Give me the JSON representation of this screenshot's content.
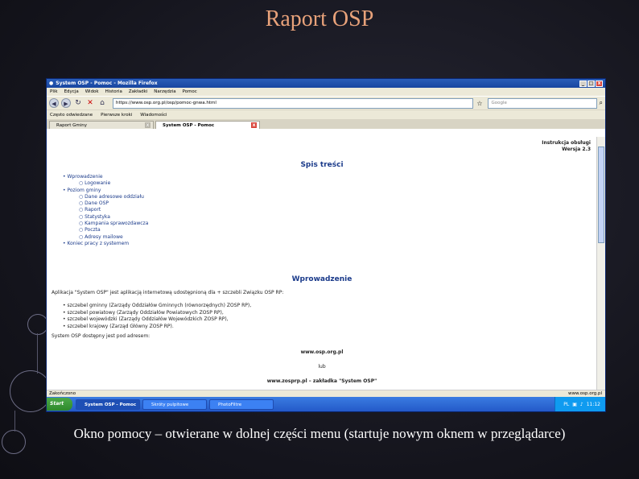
{
  "slide": {
    "title": "Raport OSP",
    "caption": "Okno pomocy – otwierane w dolnej części menu (startuje nowym oknem w przeglądarce)"
  },
  "browser": {
    "window_title": "System OSP - Pomoc - Mozilla Firefox",
    "menu": [
      "Plik",
      "Edycja",
      "Widok",
      "Historia",
      "Zakładki",
      "Narzędzia",
      "Pomoc"
    ],
    "url": "https://www.osp.org.pl/osp/pomoc-gnwa.html",
    "search_placeholder": "Google",
    "bookmarks": [
      "Często odwiedzane",
      "Pierwsze kroki",
      "Wiadomości"
    ],
    "tabs": [
      {
        "label": "Raport Gminy",
        "active": false
      },
      {
        "label": "System OSP - Pomoc",
        "active": true
      }
    ],
    "status_left": "Zakończono",
    "status_right": "www.osp.org.pl"
  },
  "page": {
    "version_line1": "Instrukcja obsługi",
    "version_line2": "Wersja 2.3",
    "toc_heading": "Spis treści",
    "toc": [
      {
        "level": 1,
        "text": "Wprowadzenie"
      },
      {
        "level": 2,
        "text": "Logowanie"
      },
      {
        "level": 1,
        "text": "Poziom gminy"
      },
      {
        "level": 2,
        "text": "Dane adresowe oddziału"
      },
      {
        "level": 2,
        "text": "Dane OSP"
      },
      {
        "level": 2,
        "text": "Raport"
      },
      {
        "level": 2,
        "text": "Statystyka"
      },
      {
        "level": 2,
        "text": "Kampania sprawozdawcza"
      },
      {
        "level": 2,
        "text": "Poczta"
      },
      {
        "level": 2,
        "text": "Adresy mailowe"
      },
      {
        "level": 1,
        "text": "Koniec pracy z systemem"
      }
    ],
    "intro_heading": "Wprowadzenie",
    "intro_text": "Aplikacja \"System OSP\" jest aplikacją internetową udostępnioną dla + szczebli Związku OSP RP:",
    "levels": [
      "szczebel gminny (Zarządy Oddziałów Gminnych (równorzędnych) ZOSP RP),",
      "szczebel powiatowy (Zarządy Oddziałów Powiatowych ZOSP RP),",
      "szczebel wojewódzki (Zarządy Oddziałów Wojewódzkich ZOSP RP),",
      "szczebel krajowy (Zarząd Główny ZOSP RP)."
    ],
    "available_text": "System OSP dostępny jest pod adresem:",
    "addr1": "www.osp.org.pl",
    "or_text": "lub",
    "addr2": "www.zosprp.pl – zakładka \"System OSP\""
  },
  "taskbar": {
    "start": "Start",
    "tasks": [
      {
        "label": "System OSP - Pomoc ...",
        "active": true
      },
      {
        "label": "Skróty pulpitowe",
        "active": false
      },
      {
        "label": "PhotoFiltre",
        "active": false
      }
    ],
    "lang": "PL",
    "clock": "11:12"
  }
}
